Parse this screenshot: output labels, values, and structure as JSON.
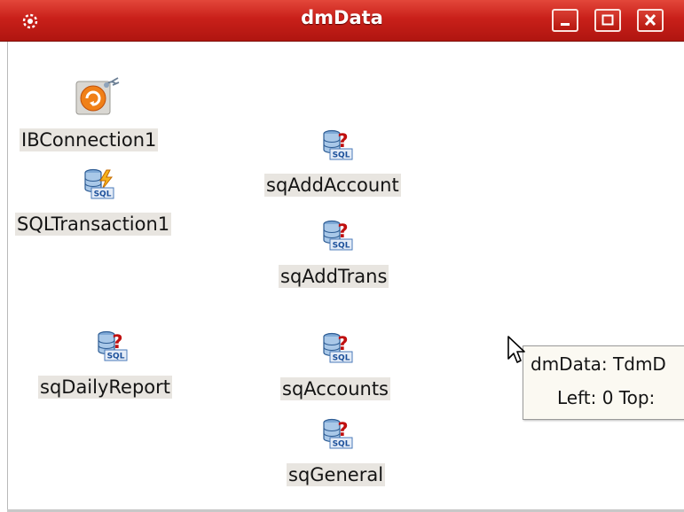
{
  "window": {
    "title": "dmData"
  },
  "components": [
    {
      "name": "IBConnection1",
      "icon": "ib-connection-icon"
    },
    {
      "name": "SQLTransaction1",
      "icon": "sql-transaction-icon"
    },
    {
      "name": "sqAddAccount",
      "icon": "sql-query-icon"
    },
    {
      "name": "sqAddTrans",
      "icon": "sql-query-icon"
    },
    {
      "name": "sqDailyReport",
      "icon": "sql-query-icon"
    },
    {
      "name": "sqAccounts",
      "icon": "sql-query-icon"
    },
    {
      "name": "sqGeneral",
      "icon": "sql-query-icon"
    }
  ],
  "tooltip": {
    "line1": "dmData: TdmD",
    "line2": "Left: 0  Top:"
  },
  "colors": {
    "titlebar": "#c9201a",
    "label_bg": "#e8e5e0",
    "tooltip_bg": "#fbf9f2"
  }
}
